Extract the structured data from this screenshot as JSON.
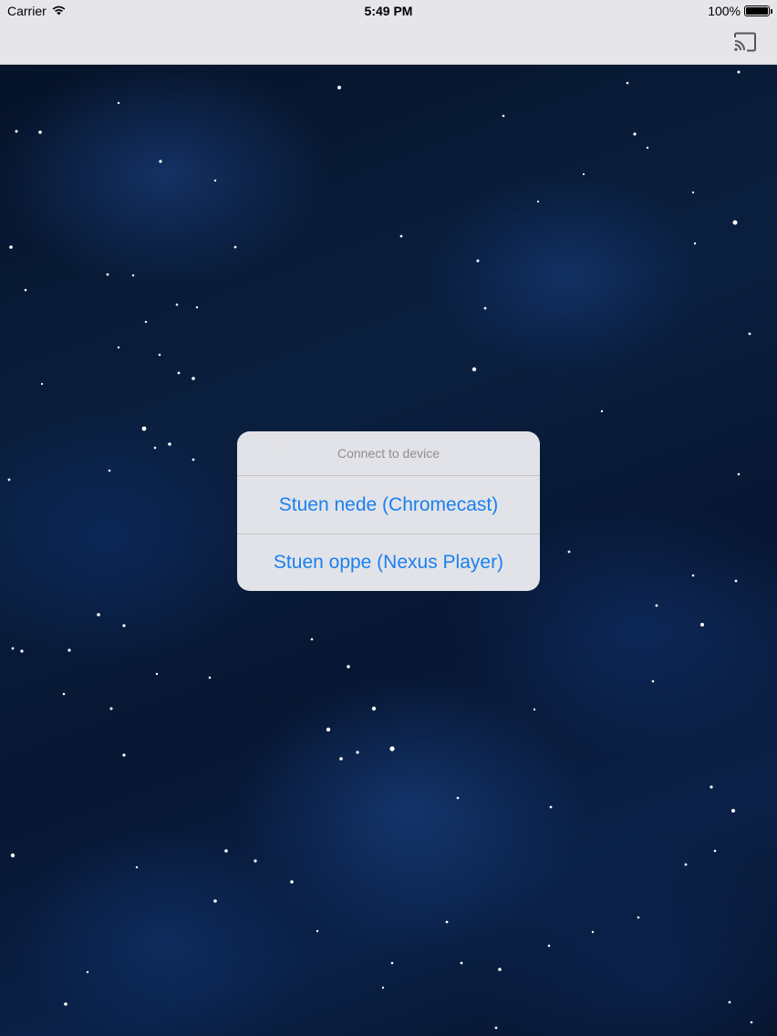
{
  "status_bar": {
    "carrier": "Carrier",
    "time": "5:49 PM",
    "battery_percent": "100%",
    "battery_level": 1.0
  },
  "toolbar": {
    "cast_icon": "cast-icon"
  },
  "dialog": {
    "title": "Connect to device",
    "options": [
      {
        "label": "Stuen nede (Chromecast)"
      },
      {
        "label": "Stuen oppe (Nexus Player)"
      }
    ]
  },
  "colors": {
    "accent": "#1a80f0",
    "bar_background": "#e6e6ea",
    "background": "#0a1f3f"
  }
}
